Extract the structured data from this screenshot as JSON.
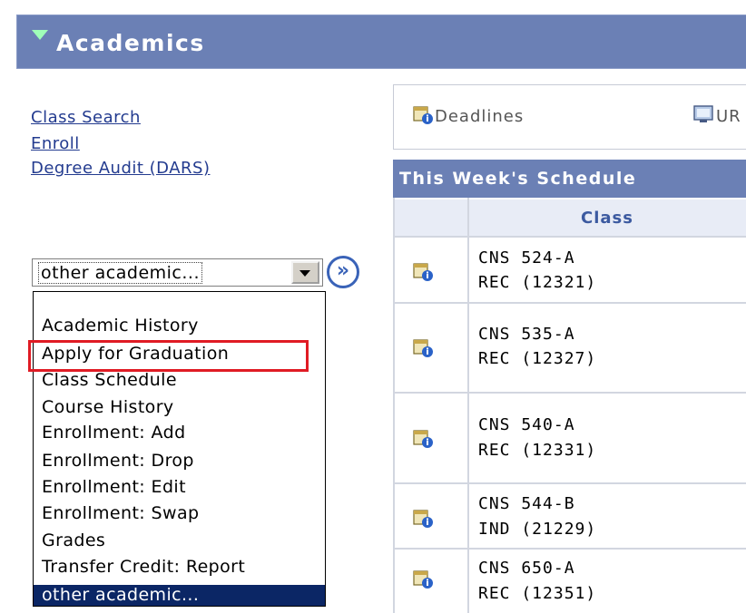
{
  "header": {
    "title": "Academics"
  },
  "links": {
    "class_search": "Class Search",
    "enroll": "Enroll",
    "degree_audit": "Degree Audit (DARS)"
  },
  "select": {
    "value": "other academic...",
    "go_label": "»",
    "options": [
      "",
      "Academic History",
      "Apply for Graduation",
      "Class Schedule",
      "Course History",
      "Enrollment: Add",
      "Enrollment: Drop",
      "Enrollment: Edit",
      "Enrollment: Swap",
      "Grades",
      "Transfer Credit: Report",
      "other academic..."
    ]
  },
  "toolbar": {
    "deadlines": "Deadlines",
    "ur_label": "UR"
  },
  "schedule": {
    "title": "This Week's Schedule",
    "column": "Class",
    "rows": [
      {
        "course": "CNS 524-A",
        "section": "REC (12321)"
      },
      {
        "course": "CNS 535-A",
        "section": "REC (12327)"
      },
      {
        "course": "CNS 540-A",
        "section": "REC (12331)"
      },
      {
        "course": "CNS 544-B",
        "section": "IND (21229)"
      },
      {
        "course": "CNS 650-A",
        "section": "REC (12351)"
      }
    ]
  },
  "colors": {
    "header_bg": "#6b80b5",
    "link": "#233b8f",
    "selected_bg": "#0b2665",
    "highlight": "#e01b24"
  }
}
